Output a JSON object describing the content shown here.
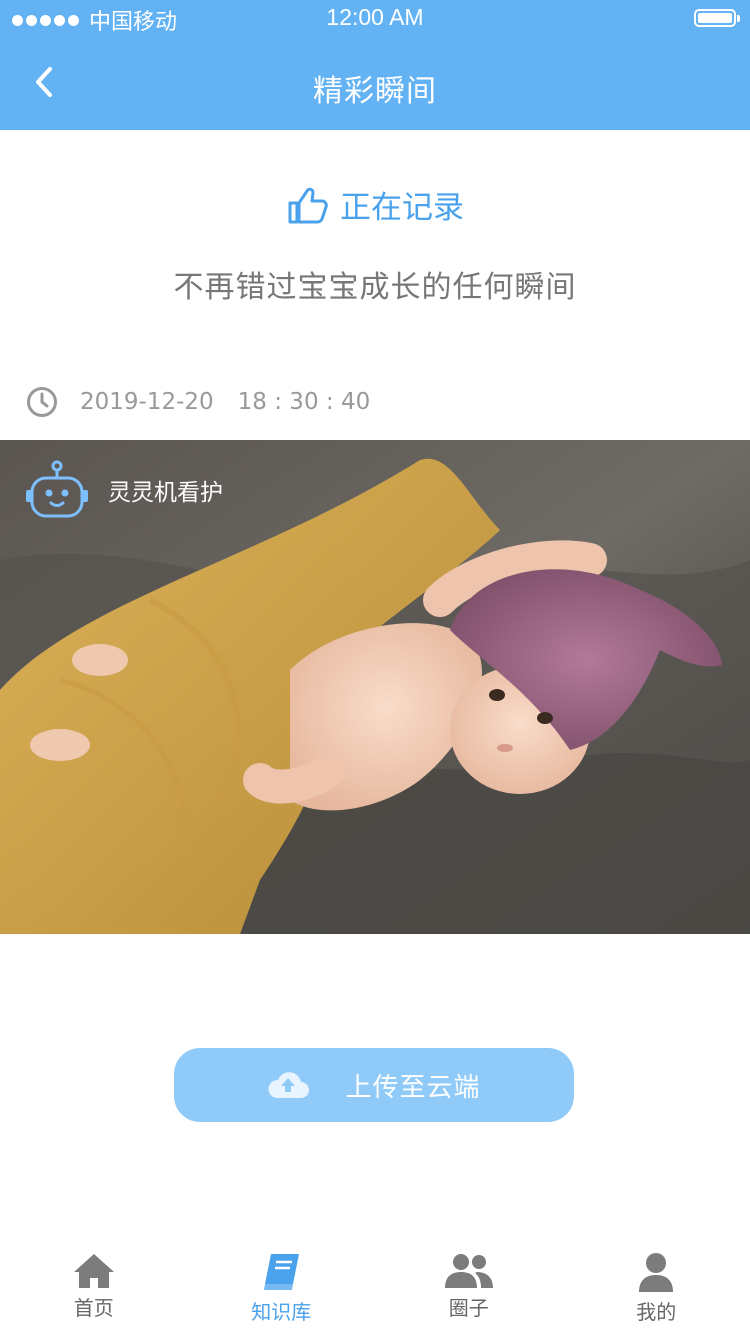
{
  "status_bar": {
    "carrier": "中国移动",
    "time": "12:00 AM"
  },
  "nav": {
    "title": "精彩瞬间"
  },
  "recording": {
    "label": "正在记录",
    "tagline": "不再错过宝宝成长的任何瞬间"
  },
  "timestamp": {
    "date": "2019-12-20",
    "time": "18 : 30 : 40"
  },
  "photo": {
    "badge_label": "灵灵机看护"
  },
  "upload": {
    "label": "上传至云端"
  },
  "tabs": [
    {
      "label": "首页",
      "icon": "home-icon"
    },
    {
      "label": "知识库",
      "icon": "book-icon"
    },
    {
      "label": "圈子",
      "icon": "group-icon"
    },
    {
      "label": "我的",
      "icon": "user-icon"
    }
  ],
  "colors": {
    "brand": "#62b2f4",
    "accent": "#4aa2ec",
    "button": "#8fcaf8"
  }
}
